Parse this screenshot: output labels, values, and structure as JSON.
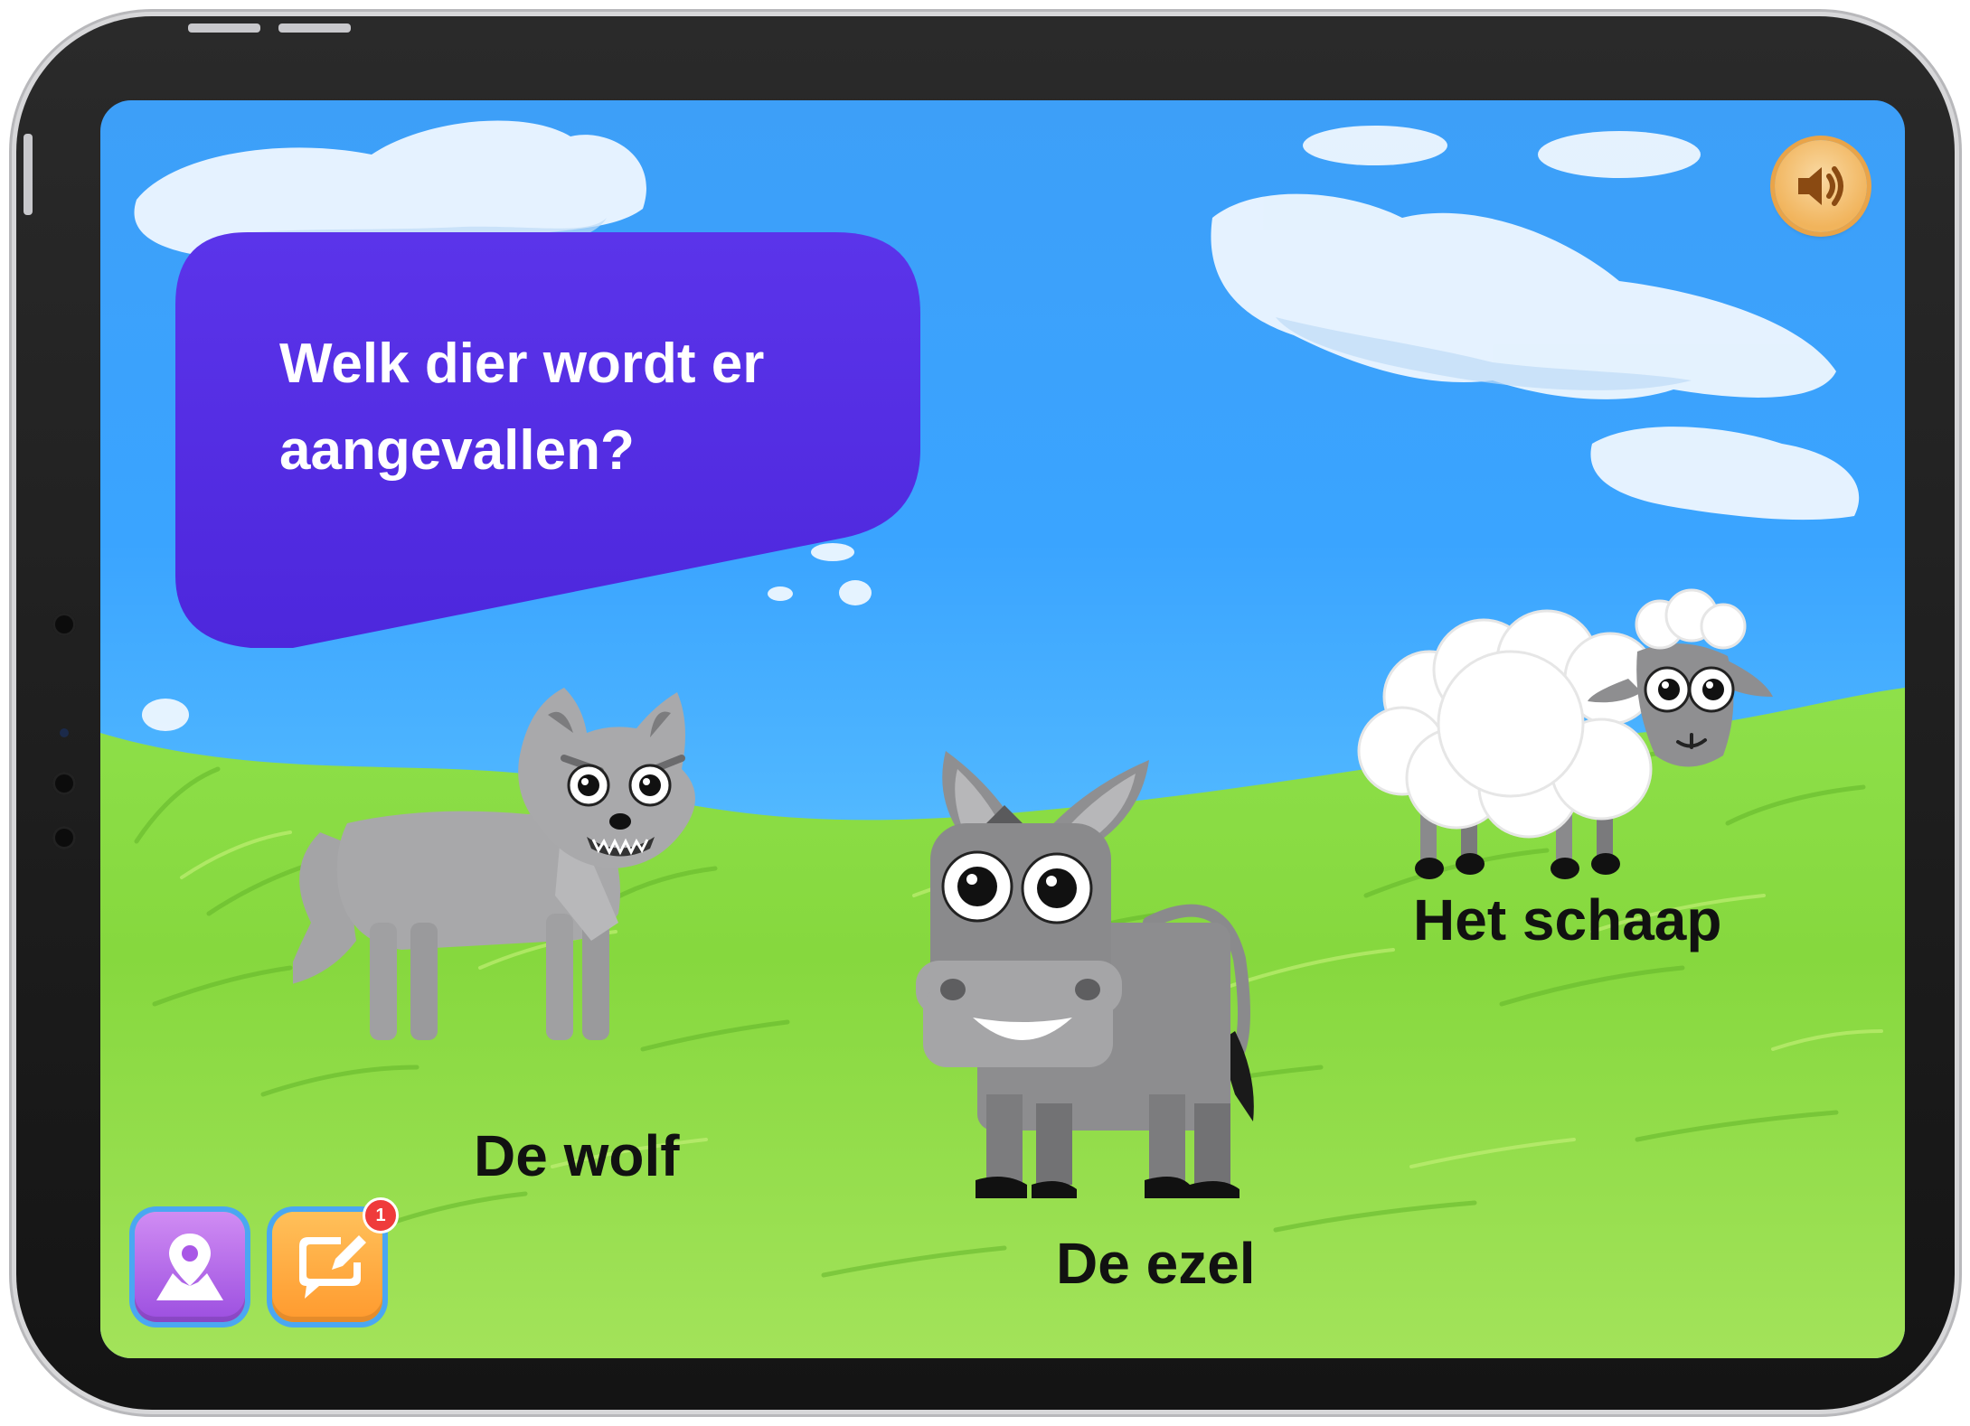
{
  "question": {
    "text": "Welk dier wordt er aangevallen?"
  },
  "answers": [
    {
      "id": "wolf",
      "label": "De wolf"
    },
    {
      "id": "donkey",
      "label": "De ezel"
    },
    {
      "id": "sheep",
      "label": "Het schaap"
    }
  ],
  "toolbar": {
    "sound_icon": "speaker-icon",
    "map_icon": "map-pin-icon",
    "chat_icon": "chat-edit-icon",
    "notification_count": "1"
  },
  "colors": {
    "bubble": "#5330e6",
    "sound_button": "#f1b45c",
    "map_button": "#b06be8",
    "chat_button": "#ffaa3c",
    "badge": "#ef3b3b"
  }
}
